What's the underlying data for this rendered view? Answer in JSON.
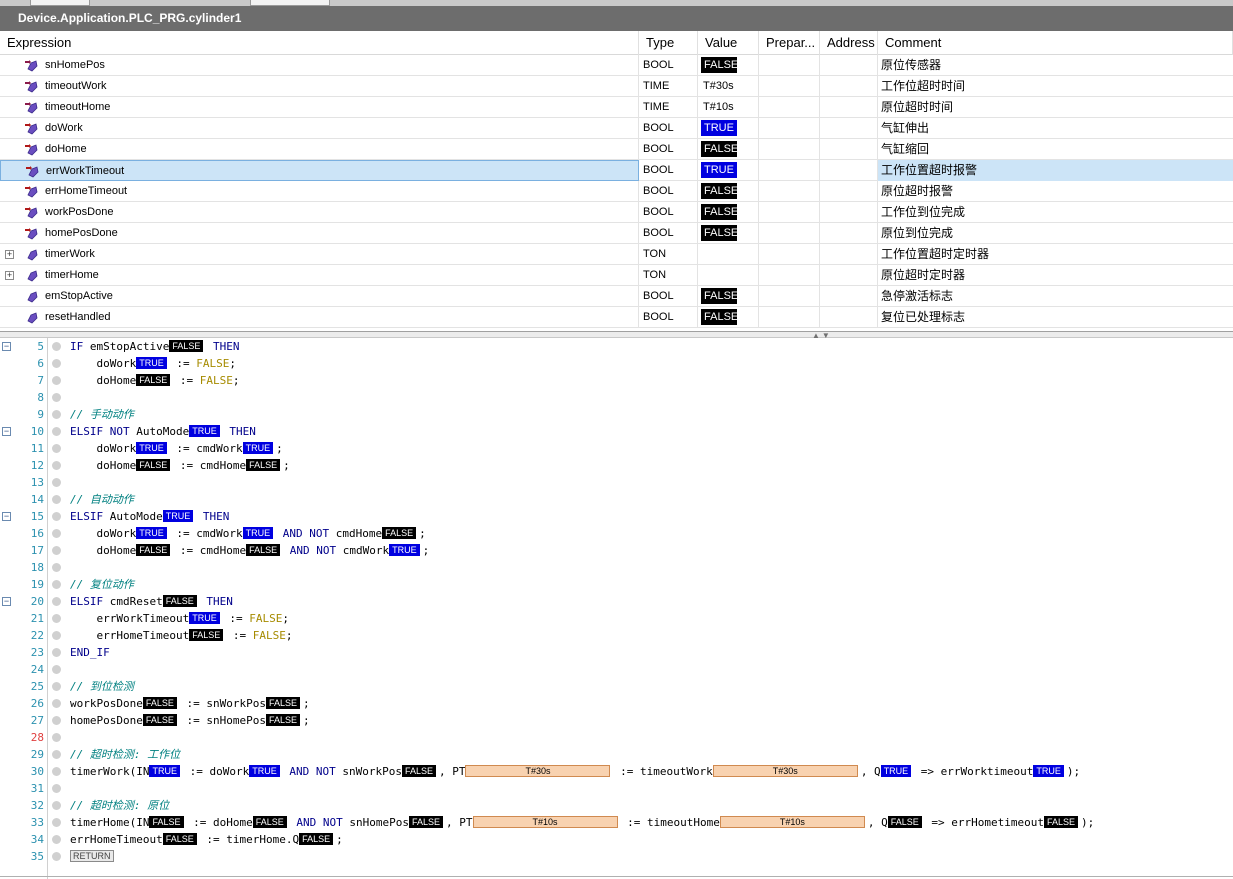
{
  "window": {
    "title": "Device.Application.PLC_PRG.cylinder1"
  },
  "watch": {
    "headers": {
      "expression": "Expression",
      "type": "Type",
      "value": "Value",
      "prepared": "Prepar...",
      "address": "Address",
      "comment": "Comment"
    },
    "rows": [
      {
        "name": "snHomePos",
        "type": "BOOL",
        "value": "FALSE",
        "value_style": "false",
        "comment": "原位传感器",
        "icon": "input-variable-icon",
        "expandable": false
      },
      {
        "name": "timeoutWork",
        "type": "TIME",
        "value": "T#30s",
        "value_style": "plain",
        "comment": "工作位超时时间",
        "icon": "input-variable-icon",
        "expandable": false
      },
      {
        "name": "timeoutHome",
        "type": "TIME",
        "value": "T#10s",
        "value_style": "plain",
        "comment": "原位超时时间",
        "icon": "input-variable-icon",
        "expandable": false
      },
      {
        "name": "doWork",
        "type": "BOOL",
        "value": "TRUE",
        "value_style": "true",
        "comment": "气缸伸出",
        "icon": "output-variable-icon",
        "expandable": false
      },
      {
        "name": "doHome",
        "type": "BOOL",
        "value": "FALSE",
        "value_style": "false",
        "comment": "气缸缩回",
        "icon": "output-variable-icon",
        "expandable": false
      },
      {
        "name": "errWorkTimeout",
        "type": "BOOL",
        "value": "TRUE",
        "value_style": "true",
        "comment": "工作位置超时报警",
        "icon": "output-variable-icon",
        "expandable": false,
        "selected": true
      },
      {
        "name": "errHomeTimeout",
        "type": "BOOL",
        "value": "FALSE",
        "value_style": "false",
        "comment": "原位超时报警",
        "icon": "output-variable-icon",
        "expandable": false
      },
      {
        "name": "workPosDone",
        "type": "BOOL",
        "value": "FALSE",
        "value_style": "false",
        "comment": "工作位到位完成",
        "icon": "output-variable-icon",
        "expandable": false
      },
      {
        "name": "homePosDone",
        "type": "BOOL",
        "value": "FALSE",
        "value_style": "false",
        "comment": "原位到位完成",
        "icon": "output-variable-icon",
        "expandable": false
      },
      {
        "name": "timerWork",
        "type": "TON",
        "value": "",
        "value_style": "plain",
        "comment": "工作位置超时定时器",
        "icon": "local-variable-icon",
        "expandable": true
      },
      {
        "name": "timerHome",
        "type": "TON",
        "value": "",
        "value_style": "plain",
        "comment": "原位超时定时器",
        "icon": "local-variable-icon",
        "expandable": true
      },
      {
        "name": "emStopActive",
        "type": "BOOL",
        "value": "FALSE",
        "value_style": "false",
        "comment": "急停激活标志",
        "icon": "local-variable-icon",
        "expandable": false
      },
      {
        "name": "resetHandled",
        "type": "BOOL",
        "value": "FALSE",
        "value_style": "false",
        "comment": "复位已处理标志",
        "icon": "local-variable-icon",
        "expandable": false
      }
    ]
  },
  "code": {
    "lines": [
      {
        "n": "5",
        "fold": true,
        "parts": [
          {
            "t": "IF",
            "c": "kw"
          },
          {
            "t": " emStopActive"
          },
          {
            "iv": "FALSE"
          },
          {
            "t": " "
          },
          {
            "t": "THEN",
            "c": "kw"
          }
        ]
      },
      {
        "n": "6",
        "parts": [
          {
            "t": "    doWork"
          },
          {
            "iv": "TRUE"
          },
          {
            "t": " := "
          },
          {
            "t": "FALSE",
            "c": "lit"
          },
          {
            "t": ";"
          }
        ]
      },
      {
        "n": "7",
        "parts": [
          {
            "t": "    doHome"
          },
          {
            "iv": "FALSE"
          },
          {
            "t": " := "
          },
          {
            "t": "FALSE",
            "c": "lit"
          },
          {
            "t": ";"
          }
        ]
      },
      {
        "n": "8",
        "parts": []
      },
      {
        "n": "9",
        "parts": [
          {
            "t": "// 手动动作",
            "c": "cm"
          }
        ]
      },
      {
        "n": "10",
        "fold": true,
        "parts": [
          {
            "t": "ELSIF",
            "c": "kw"
          },
          {
            "t": " "
          },
          {
            "t": "NOT",
            "c": "kw"
          },
          {
            "t": " AutoMode"
          },
          {
            "iv": "TRUE"
          },
          {
            "t": " "
          },
          {
            "t": "THEN",
            "c": "kw"
          }
        ]
      },
      {
        "n": "11",
        "parts": [
          {
            "t": "    doWork"
          },
          {
            "iv": "TRUE"
          },
          {
            "t": " := cmdWork"
          },
          {
            "iv": "TRUE"
          },
          {
            "t": ";"
          }
        ]
      },
      {
        "n": "12",
        "parts": [
          {
            "t": "    doHome"
          },
          {
            "iv": "FALSE"
          },
          {
            "t": " := cmdHome"
          },
          {
            "iv": "FALSE"
          },
          {
            "t": ";"
          }
        ]
      },
      {
        "n": "13",
        "parts": []
      },
      {
        "n": "14",
        "parts": [
          {
            "t": "// 自动动作",
            "c": "cm"
          }
        ]
      },
      {
        "n": "15",
        "fold": true,
        "parts": [
          {
            "t": "ELSIF",
            "c": "kw"
          },
          {
            "t": " AutoMode"
          },
          {
            "iv": "TRUE"
          },
          {
            "t": " "
          },
          {
            "t": "THEN",
            "c": "kw"
          }
        ]
      },
      {
        "n": "16",
        "parts": [
          {
            "t": "    doWork"
          },
          {
            "iv": "TRUE"
          },
          {
            "t": " := cmdWork"
          },
          {
            "iv": "TRUE"
          },
          {
            "t": " "
          },
          {
            "t": "AND",
            "c": "kw"
          },
          {
            "t": " "
          },
          {
            "t": "NOT",
            "c": "kw"
          },
          {
            "t": " cmdHome"
          },
          {
            "iv": "FALSE"
          },
          {
            "t": ";"
          }
        ]
      },
      {
        "n": "17",
        "parts": [
          {
            "t": "    doHome"
          },
          {
            "iv": "FALSE"
          },
          {
            "t": " := cmdHome"
          },
          {
            "iv": "FALSE"
          },
          {
            "t": " "
          },
          {
            "t": "AND",
            "c": "kw"
          },
          {
            "t": " "
          },
          {
            "t": "NOT",
            "c": "kw"
          },
          {
            "t": " cmdWork"
          },
          {
            "iv": "TRUE"
          },
          {
            "t": ";"
          }
        ]
      },
      {
        "n": "18",
        "parts": []
      },
      {
        "n": "19",
        "parts": [
          {
            "t": "// 复位动作",
            "c": "cm"
          }
        ]
      },
      {
        "n": "20",
        "fold": true,
        "parts": [
          {
            "t": "ELSIF",
            "c": "kw"
          },
          {
            "t": " cmdReset"
          },
          {
            "iv": "FALSE"
          },
          {
            "t": " "
          },
          {
            "t": "THEN",
            "c": "kw"
          }
        ]
      },
      {
        "n": "21",
        "parts": [
          {
            "t": "    errWorkTimeout"
          },
          {
            "iv": "TRUE"
          },
          {
            "t": " := "
          },
          {
            "t": "FALSE",
            "c": "lit"
          },
          {
            "t": ";"
          }
        ]
      },
      {
        "n": "22",
        "parts": [
          {
            "t": "    errHomeTimeout"
          },
          {
            "iv": "FALSE"
          },
          {
            "t": " := "
          },
          {
            "t": "FALSE",
            "c": "lit"
          },
          {
            "t": ";"
          }
        ]
      },
      {
        "n": "23",
        "parts": [
          {
            "t": "END_IF",
            "c": "kw"
          }
        ]
      },
      {
        "n": "24",
        "parts": []
      },
      {
        "n": "25",
        "parts": [
          {
            "t": "// 到位检测",
            "c": "cm"
          }
        ]
      },
      {
        "n": "26",
        "parts": [
          {
            "t": "workPosDone"
          },
          {
            "iv": "FALSE"
          },
          {
            "t": " := snWorkPos"
          },
          {
            "iv": "FALSE"
          },
          {
            "t": ";"
          }
        ]
      },
      {
        "n": "27",
        "parts": [
          {
            "t": "homePosDone"
          },
          {
            "iv": "FALSE"
          },
          {
            "t": " := snHomePos"
          },
          {
            "iv": "FALSE"
          },
          {
            "t": ";"
          }
        ]
      },
      {
        "n": "28",
        "red": true,
        "parts": []
      },
      {
        "n": "29",
        "parts": [
          {
            "t": "// 超时检测: 工作位",
            "c": "cm"
          }
        ]
      },
      {
        "n": "30",
        "parts": [
          {
            "t": "timerWork(IN"
          },
          {
            "iv": "TRUE"
          },
          {
            "t": " := doWork"
          },
          {
            "iv": "TRUE"
          },
          {
            "t": " "
          },
          {
            "t": "AND",
            "c": "kw"
          },
          {
            "t": " "
          },
          {
            "t": "NOT",
            "c": "kw"
          },
          {
            "t": " snWorkPos"
          },
          {
            "iv": "FALSE"
          },
          {
            "t": ", PT"
          },
          {
            "ivt": "T#30s"
          },
          {
            "t": " := timeoutWork"
          },
          {
            "ivt": "T#30s"
          },
          {
            "t": ", Q"
          },
          {
            "iv": "TRUE"
          },
          {
            "t": " => errWorktimeout"
          },
          {
            "iv": "TRUE"
          },
          {
            "t": ");"
          }
        ]
      },
      {
        "n": "31",
        "parts": []
      },
      {
        "n": "32",
        "parts": [
          {
            "t": "// 超时检测: 原位",
            "c": "cm"
          }
        ]
      },
      {
        "n": "33",
        "parts": [
          {
            "t": "timerHome(IN"
          },
          {
            "iv": "FALSE"
          },
          {
            "t": " := doHome"
          },
          {
            "iv": "FALSE"
          },
          {
            "t": " "
          },
          {
            "t": "AND",
            "c": "kw"
          },
          {
            "t": " "
          },
          {
            "t": "NOT",
            "c": "kw"
          },
          {
            "t": " snHomePos"
          },
          {
            "iv": "FALSE"
          },
          {
            "t": ", PT"
          },
          {
            "ivt": "T#10s"
          },
          {
            "t": " := timeoutHome"
          },
          {
            "ivt": "T#10s"
          },
          {
            "t": ", Q"
          },
          {
            "iv": "FALSE"
          },
          {
            "t": " => errHometimeout"
          },
          {
            "iv": "FALSE"
          },
          {
            "t": ");"
          }
        ]
      },
      {
        "n": "34",
        "parts": [
          {
            "t": "errHomeTimeout"
          },
          {
            "iv": "FALSE"
          },
          {
            "t": " := timerHome.Q"
          },
          {
            "iv": "FALSE"
          },
          {
            "t": ";"
          }
        ]
      },
      {
        "n": "35",
        "parts": [
          {
            "ret": "RETURN"
          }
        ]
      }
    ]
  }
}
